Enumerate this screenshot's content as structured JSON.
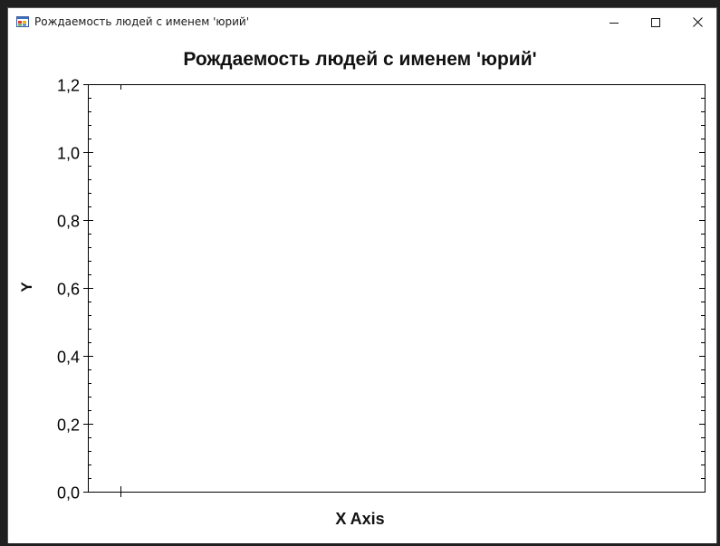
{
  "window": {
    "title": "Рождаемость людей с именем 'юрий'",
    "icon": "winforms-app-icon",
    "controls": {
      "minimize": "minimize-icon",
      "maximize": "maximize-icon",
      "close": "close-icon"
    }
  },
  "chart_data": {
    "type": "line",
    "title": "Рождаемость людей с именем 'юрий'",
    "xlabel": "X Axis",
    "ylabel": "Y",
    "ylim": [
      0,
      1.2
    ],
    "y_ticks": [
      "0,0",
      "0,2",
      "0,4",
      "0,6",
      "0,8",
      "1,0",
      "1,2"
    ],
    "series": [],
    "grid": false,
    "legend": "none"
  },
  "colors": {
    "axis": "#000000",
    "background": "#ffffff",
    "frame": "#202020"
  }
}
